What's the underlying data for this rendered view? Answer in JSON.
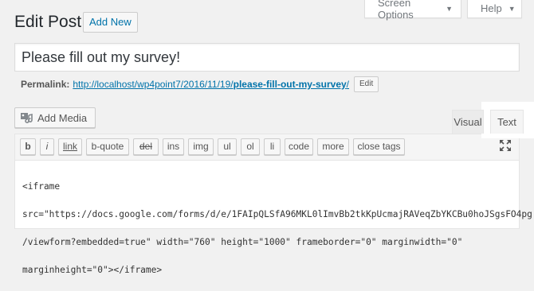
{
  "header": {
    "page_title": "Edit Post",
    "add_new_label": "Add New",
    "screen_options_label": "Screen Options",
    "help_label": "Help"
  },
  "post": {
    "title_value": "Please fill out my survey!"
  },
  "permalink": {
    "label": "Permalink:",
    "url_base": "http://localhost/wp4point7/2016/11/19/",
    "slug": "please-fill-out-my-survey",
    "url_end": "/",
    "edit_label": "Edit"
  },
  "editor": {
    "add_media_label": "Add Media",
    "tab_visual": "Visual",
    "tab_text": "Text",
    "quicktags": [
      "b",
      "i",
      "link",
      "b-quote",
      "del",
      "ins",
      "img",
      "ul",
      "ol",
      "li",
      "code",
      "more",
      "close tags"
    ],
    "content_lines": [
      "<iframe",
      "src=\"https://docs.google.com/forms/d/e/1FAIpQLSfA96MKL0lImvBb2tkKpUcmajRAVeqZbYKCBu0hoJSgsFO4pg",
      "/viewform?embedded=true\" width=\"760\" height=\"1000\" frameborder=\"0\" marginwidth=\"0\"",
      "marginheight=\"0\"></iframe>"
    ]
  },
  "icons": {
    "dropdown": "caret-down-icon",
    "media": "media-icon",
    "expand": "fullscreen-icon"
  }
}
